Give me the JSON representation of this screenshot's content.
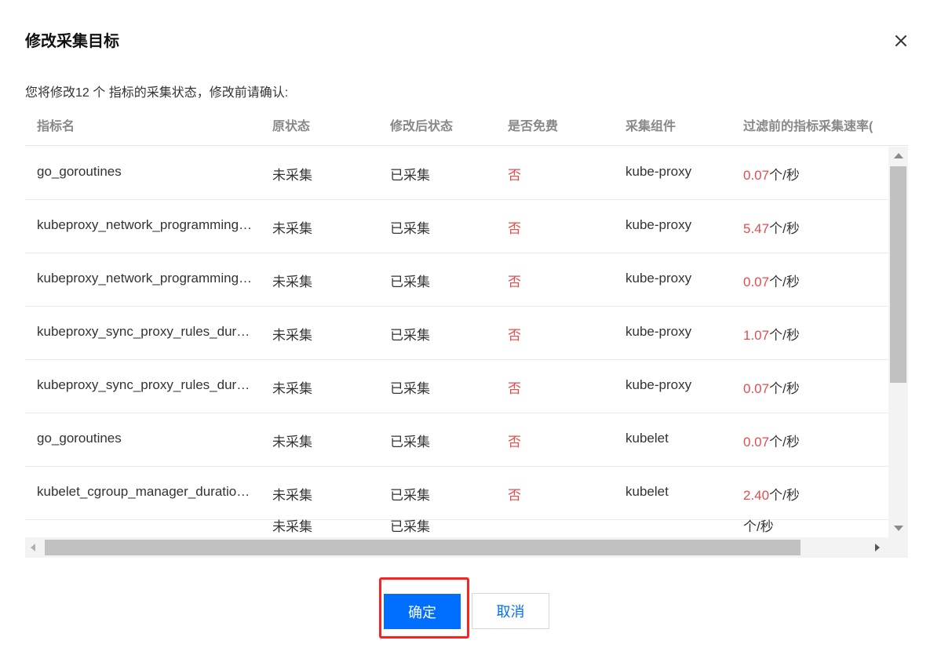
{
  "dialog": {
    "title": "修改采集目标",
    "description": "您将修改12 个 指标的采集状态，修改前请确认:"
  },
  "table": {
    "columns": [
      "指标名",
      "原状态",
      "修改后状态",
      "是否免费",
      "采集组件",
      "过滤前的指标采集速率("
    ],
    "rows": [
      {
        "name": "go_goroutines",
        "orig": "未采集",
        "new": "已采集",
        "free": "否",
        "component": "kube-proxy",
        "rate": "0.07",
        "unit": "个/秒"
      },
      {
        "name": "kubeproxy_network_programming_duration_seconds_bucket",
        "orig": "未采集",
        "new": "已采集",
        "free": "否",
        "component": "kube-proxy",
        "rate": "5.47",
        "unit": "个/秒"
      },
      {
        "name": "kubeproxy_network_programming_duration_seconds_count",
        "orig": "未采集",
        "new": "已采集",
        "free": "否",
        "component": "kube-proxy",
        "rate": "0.07",
        "unit": "个/秒"
      },
      {
        "name": "kubeproxy_sync_proxy_rules_duration_seconds_bucket",
        "orig": "未采集",
        "new": "已采集",
        "free": "否",
        "component": "kube-proxy",
        "rate": "1.07",
        "unit": "个/秒"
      },
      {
        "name": "kubeproxy_sync_proxy_rules_duration_seconds_count",
        "orig": "未采集",
        "new": "已采集",
        "free": "否",
        "component": "kube-proxy",
        "rate": "0.07",
        "unit": "个/秒"
      },
      {
        "name": "go_goroutines",
        "orig": "未采集",
        "new": "已采集",
        "free": "否",
        "component": "kubelet",
        "rate": "0.07",
        "unit": "个/秒"
      },
      {
        "name": "kubelet_cgroup_manager_duration_seconds_bucket",
        "orig": "未采集",
        "new": "已采集",
        "free": "否",
        "component": "kubelet",
        "rate": "2.40",
        "unit": "个/秒"
      },
      {
        "name": "",
        "orig": "未采集",
        "new": "已采集",
        "free": "",
        "component": "",
        "rate": "",
        "unit": "个/秒"
      }
    ]
  },
  "footer": {
    "ok_label": "确定",
    "cancel_label": "取消"
  },
  "colors": {
    "primary": "#006eff",
    "danger": "#e34d4d",
    "highlight": "#ff2020"
  }
}
